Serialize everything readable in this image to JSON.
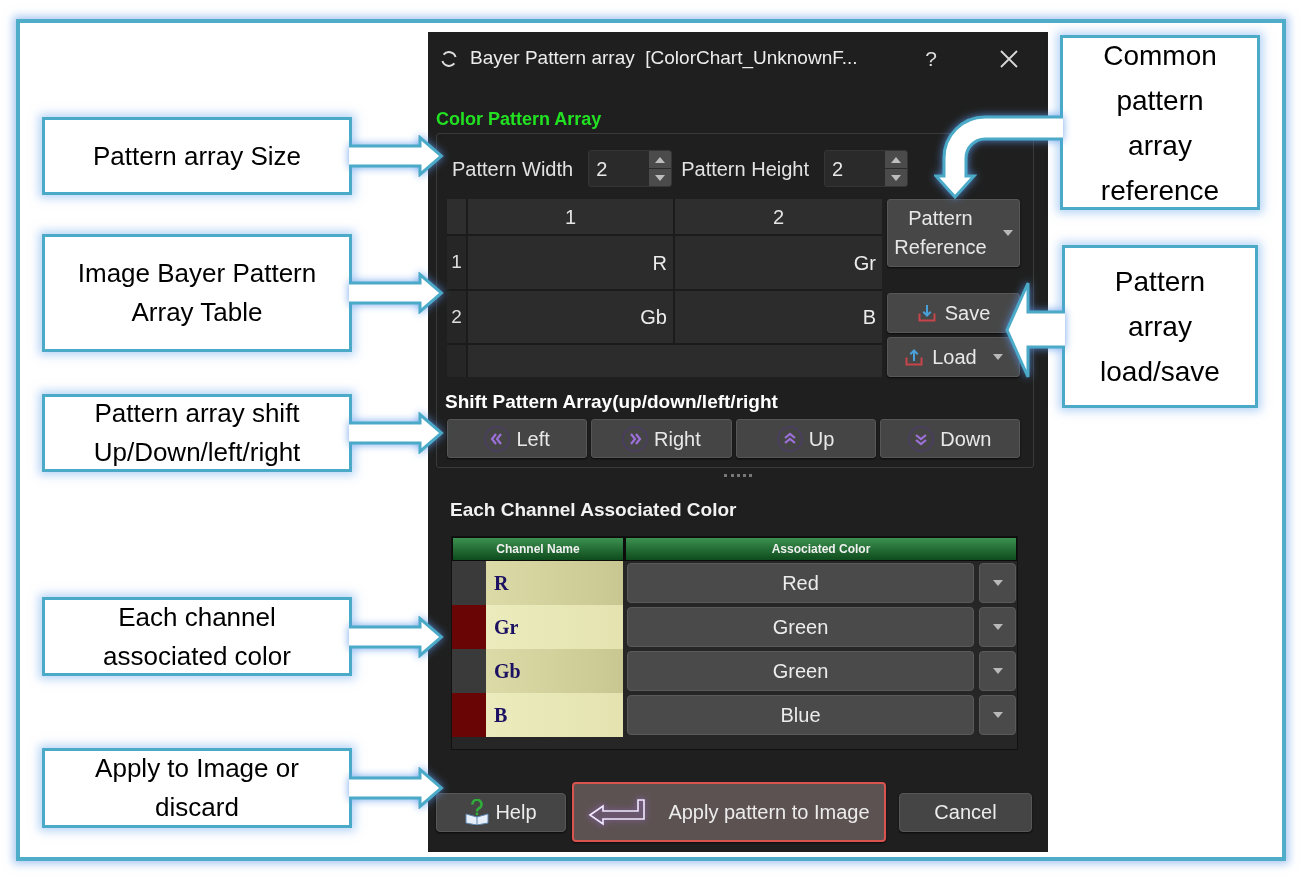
{
  "annotations": {
    "left": [
      {
        "lines": [
          "Pattern array Size"
        ]
      },
      {
        "lines": [
          "Image Bayer Pattern",
          "Array Table"
        ]
      },
      {
        "lines": [
          "Pattern array shift",
          "Up/Down/left/right"
        ]
      },
      {
        "lines": [
          "Each channel",
          "associated color"
        ]
      },
      {
        "lines": [
          "Apply to Image or",
          "discard"
        ]
      }
    ],
    "right": [
      {
        "lines": [
          "Common",
          "pattern",
          "array",
          "reference"
        ]
      },
      {
        "lines": [
          "Pattern",
          "array",
          "load/save"
        ]
      }
    ]
  },
  "dialog": {
    "title": "Bayer Pattern array  [ColorChart_UnknownF...",
    "help_button": "?",
    "pattern_section": {
      "title": "Color Pattern Array",
      "width": {
        "label": "Pattern Width",
        "value": "2"
      },
      "height": {
        "label": "Pattern Height",
        "value": "2"
      },
      "table": {
        "columns": [
          "1",
          "2"
        ],
        "rows": [
          {
            "header": "1",
            "cells": [
              "R",
              "Gr"
            ]
          },
          {
            "header": "2",
            "cells": [
              "Gb",
              "B"
            ]
          }
        ]
      },
      "side_buttons": [
        {
          "label": "Pattern Reference",
          "kind": "menu",
          "has_menu": true
        },
        {
          "label": "Save",
          "kind": "save",
          "has_menu": false
        },
        {
          "label": "Load",
          "kind": "load",
          "has_menu": true
        }
      ],
      "shift_title": "Shift Pattern Array(up/down/left/right",
      "shift_buttons": [
        {
          "label": "Left",
          "kind": "left"
        },
        {
          "label": "Right",
          "kind": "right"
        },
        {
          "label": "Up",
          "kind": "up"
        },
        {
          "label": "Down",
          "kind": "down"
        }
      ]
    },
    "channel_section": {
      "title": "Each Channel Associated Color",
      "columns": [
        "Channel Name",
        "Associated Color"
      ],
      "rows": [
        {
          "name": "R",
          "associated_color": "Red",
          "color": "#3a3a3a"
        },
        {
          "name": "Gr",
          "associated_color": "Green",
          "color": "#6a0505"
        },
        {
          "name": "Gb",
          "associated_color": "Green",
          "color": "#3a3a3a"
        },
        {
          "name": "B",
          "associated_color": "Blue",
          "color": "#6a0505"
        }
      ]
    },
    "buttons": [
      {
        "label": "Help",
        "kind": "help"
      },
      {
        "label": "Apply pattern to Image",
        "kind": "apply"
      },
      {
        "label": "Cancel",
        "kind": "cancel"
      }
    ]
  }
}
